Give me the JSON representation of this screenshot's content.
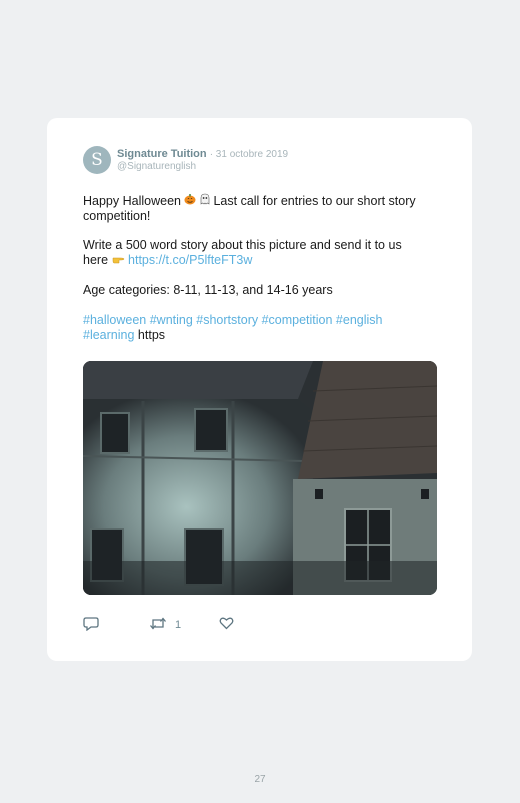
{
  "tweet": {
    "avatar_letter": "S",
    "display_name": "Signature Tuition",
    "date": "· 31 octobre 2019",
    "handle": "@Signaturenglish",
    "p1_a": "Happy Halloween",
    "p1_b": "Last call for entries to our short story",
    "p1_c": "competition!",
    "p2_a": "Write a 500 word story about this picture and send it to us",
    "p2_b": "here",
    "p2_link": "https://t.co/P5lfteFT3w",
    "p3": "Age categories: 8-11, 11-13, and 14-16 years",
    "hashtags_line1": "#halloween #wnting #shortstory #competition #english",
    "hashtags_line2": "#learning",
    "trailing": "https",
    "retweet_count": "1"
  },
  "page_number": "27",
  "icons": [
    "pumpkin-icon",
    "ghost-icon",
    "pointing-hand-icon",
    "reply-icon",
    "retweet-icon",
    "like-icon"
  ]
}
